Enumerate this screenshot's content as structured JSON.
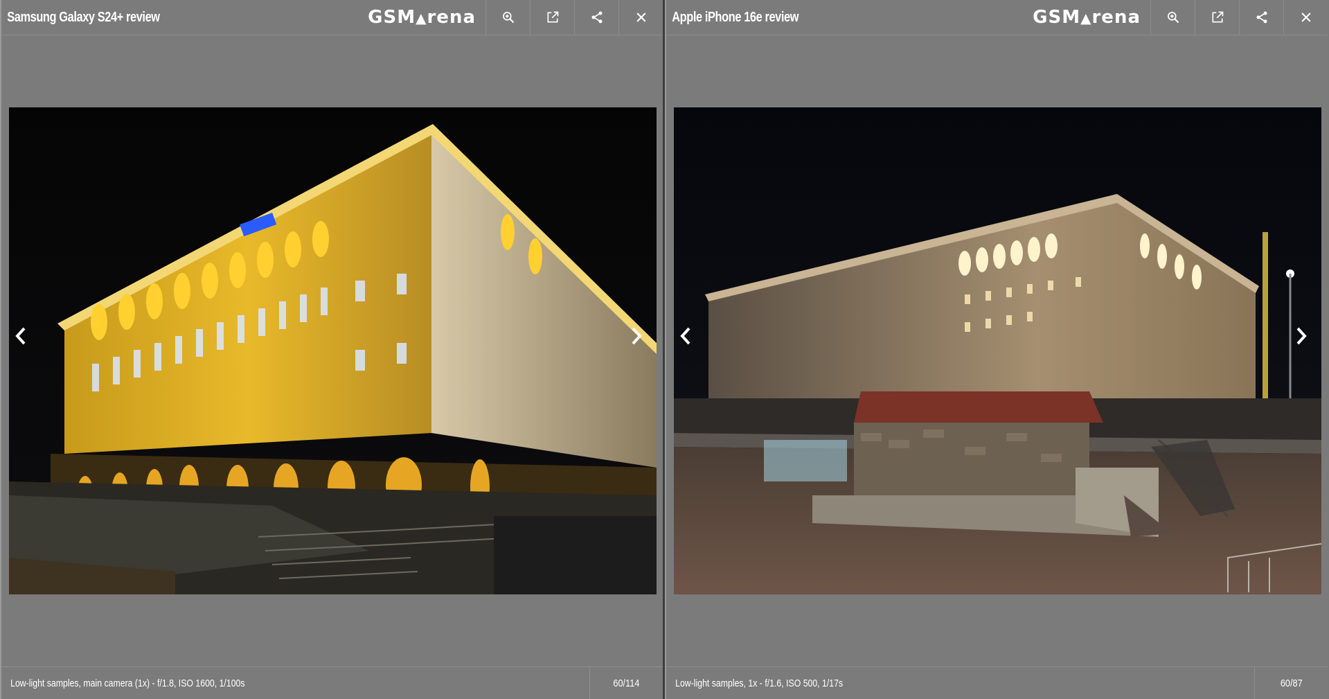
{
  "left_pane": {
    "title": "Samsung Galaxy S24+ review",
    "logo": "GSMArena",
    "caption": "Low-light samples, main camera (1x) - f/1.8, ISO 1600, 1/100s",
    "counter": "60/114",
    "icons": [
      "zoom-in-icon",
      "open-external-icon",
      "share-icon",
      "close-icon",
      "chevron-left-icon",
      "chevron-right-icon"
    ]
  },
  "right_pane": {
    "title": "Apple iPhone 16e review",
    "logo": "GSMArena",
    "caption": "Low-light samples, 1x - f/1.6, ISO 500, 1/17s",
    "counter": "60/87",
    "icons": [
      "zoom-in-icon",
      "open-external-icon",
      "share-icon",
      "close-icon",
      "chevron-left-icon",
      "chevron-right-icon"
    ]
  },
  "colors": {
    "background": "#7b7b7b",
    "divider": "#3c3c3c",
    "text": "#ffffff"
  }
}
